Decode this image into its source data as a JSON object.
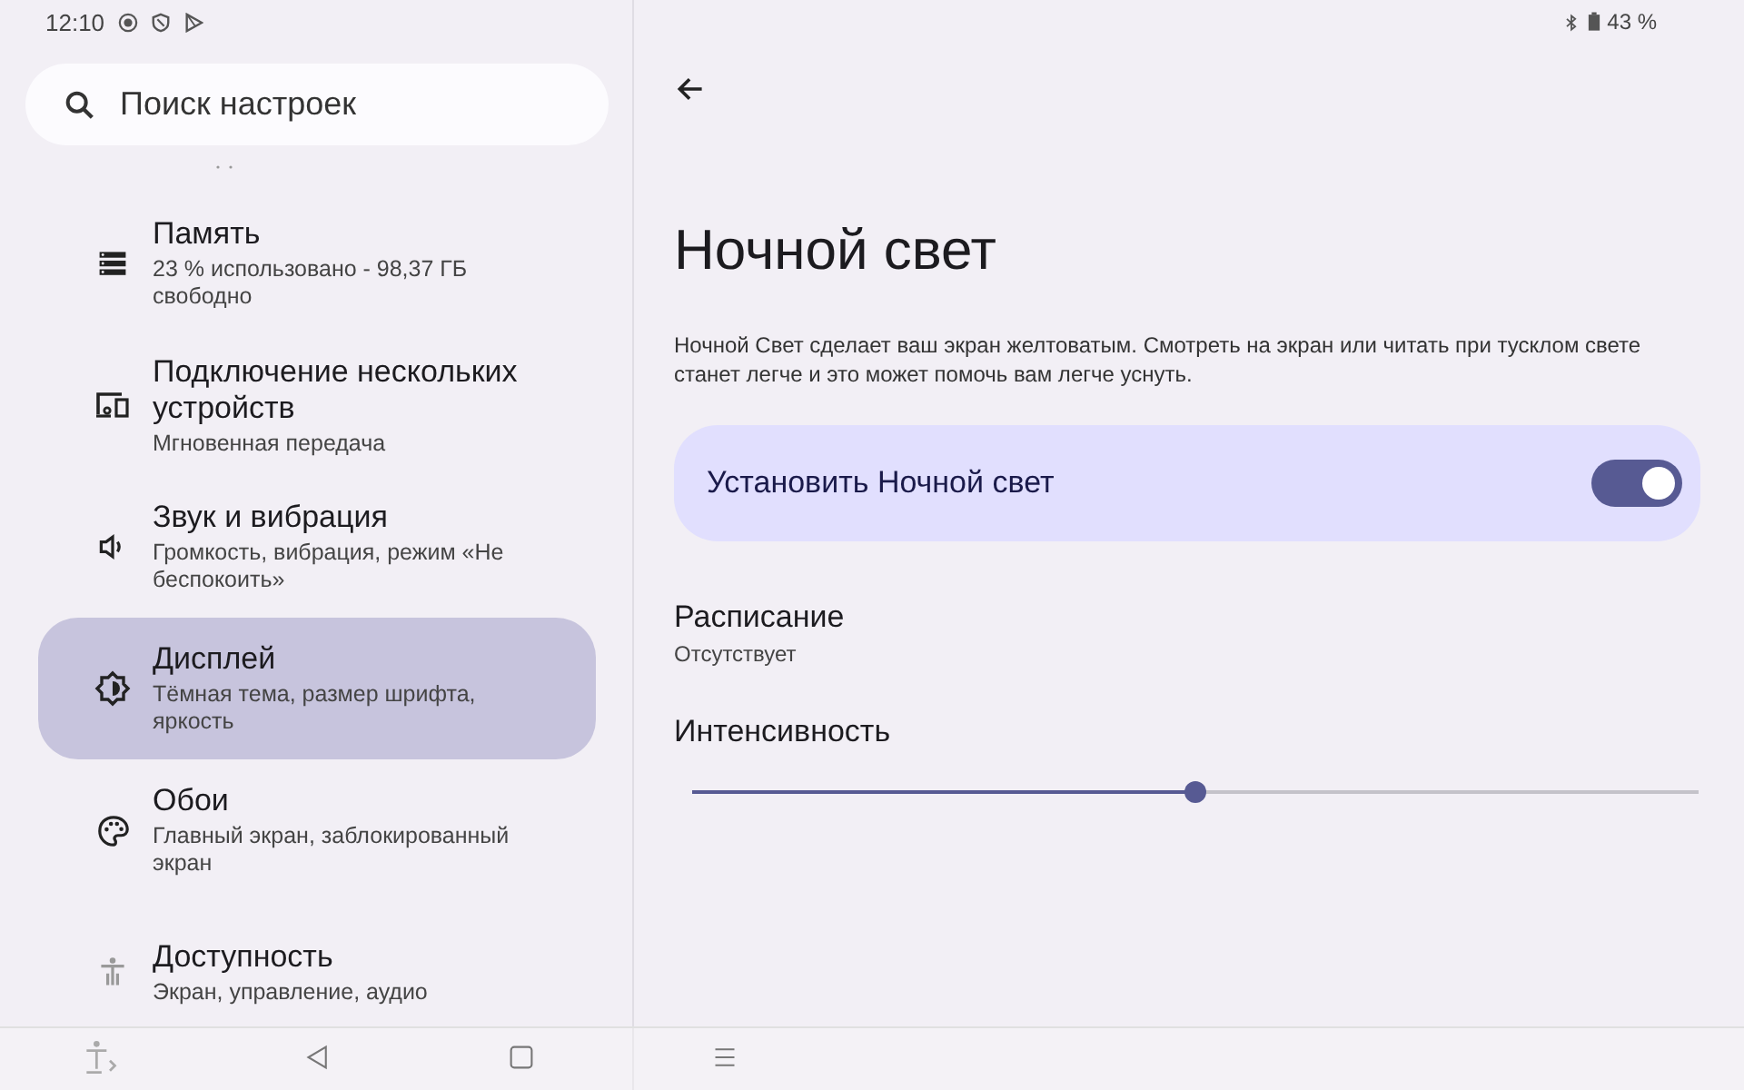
{
  "status_bar": {
    "time": "12:10",
    "battery": "43 %"
  },
  "search": {
    "placeholder": "Поиск настроек"
  },
  "settings_list": [
    {
      "kind": "storage",
      "title": "Память",
      "subtitle": "23 % использовано - 98,37 ГБ свободно",
      "selected": false
    },
    {
      "kind": "devices",
      "title": "Подключение нескольких устройств",
      "subtitle": "Мгновенная передача",
      "selected": false
    },
    {
      "kind": "sound",
      "title": "Звук и вибрация",
      "subtitle": "Громкость, вибрация, режим «Не беспокоить»",
      "selected": false
    },
    {
      "kind": "display",
      "title": "Дисплей",
      "subtitle": "Тёмная тема, размер шрифта, яркость",
      "selected": true
    },
    {
      "kind": "palette",
      "title": "Обои",
      "subtitle": "Главный экран, заблокированный экран",
      "selected": false
    },
    {
      "kind": "accessibility",
      "title": "Доступность",
      "subtitle": "Экран, управление, аудио",
      "selected": false
    }
  ],
  "detail": {
    "title": "Ночной свет",
    "description": "Ночной Свет сделает ваш экран желтоватым. Смотреть на экран или читать при тусклом свете станет легче и это может помочь вам легче уснуть.",
    "main_switch": {
      "label": "Установить Ночной свет",
      "on": true
    },
    "schedule": {
      "label": "Расписание",
      "value": "Отсутствует"
    },
    "intensity": {
      "label": "Интенсивность",
      "level": 0.5
    }
  }
}
